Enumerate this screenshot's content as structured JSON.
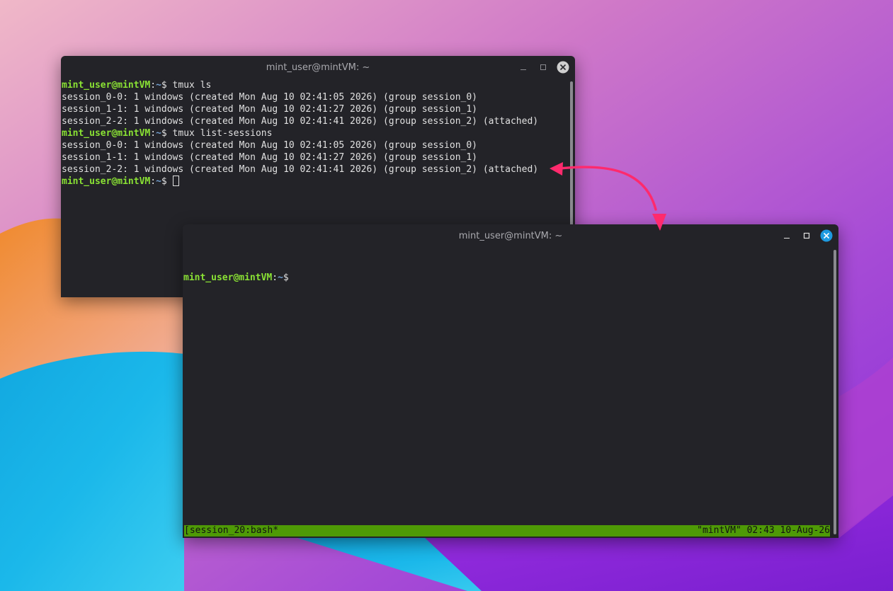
{
  "back_window": {
    "title": "mint_user@mintVM: ~",
    "prompt": {
      "user_host": "mint_user@mintVM",
      "sep": ":",
      "path": "~",
      "symbol": "$ "
    },
    "lines": [
      {
        "type": "prompt",
        "cmd": "tmux ls"
      },
      {
        "type": "output",
        "text": "session_0-0: 1 windows (created Mon Aug 10 02:41:05 2026) (group session_0)"
      },
      {
        "type": "output",
        "text": "session_1-1: 1 windows (created Mon Aug 10 02:41:27 2026) (group session_1)"
      },
      {
        "type": "output",
        "text": "session_2-2: 1 windows (created Mon Aug 10 02:41:41 2026) (group session_2) (attached)"
      },
      {
        "type": "prompt",
        "cmd": "tmux list-sessions"
      },
      {
        "type": "output",
        "text": "session_0-0: 1 windows (created Mon Aug 10 02:41:05 2026) (group session_0)"
      },
      {
        "type": "output",
        "text": "session_1-1: 1 windows (created Mon Aug 10 02:41:27 2026) (group session_1)"
      },
      {
        "type": "output",
        "text": "session_2-2: 1 windows (created Mon Aug 10 02:41:41 2026) (group session_2) (attached)"
      },
      {
        "type": "prompt",
        "cmd": "",
        "cursor": true
      }
    ]
  },
  "front_window": {
    "title": "mint_user@mintVM: ~",
    "prompt": {
      "user_host": "mint_user@mintVM",
      "sep": ":",
      "path": "~",
      "symbol": "$"
    },
    "status_left": "[session_20:bash*",
    "status_right": "\"mintVM\" 02:43 10-Aug-26"
  },
  "colors": {
    "terminal_bg": "#232328",
    "prompt_user": "#8ae234",
    "prompt_path": "#729fcf",
    "status_bar": "#4e9a06",
    "close_active": "#1e9ae0",
    "close_inactive": "#cfcfcf",
    "annotation_arrow": "#ff2a6d"
  },
  "icons": [
    "minimize-icon",
    "maximize-icon",
    "close-icon",
    "annotation-arrow"
  ]
}
